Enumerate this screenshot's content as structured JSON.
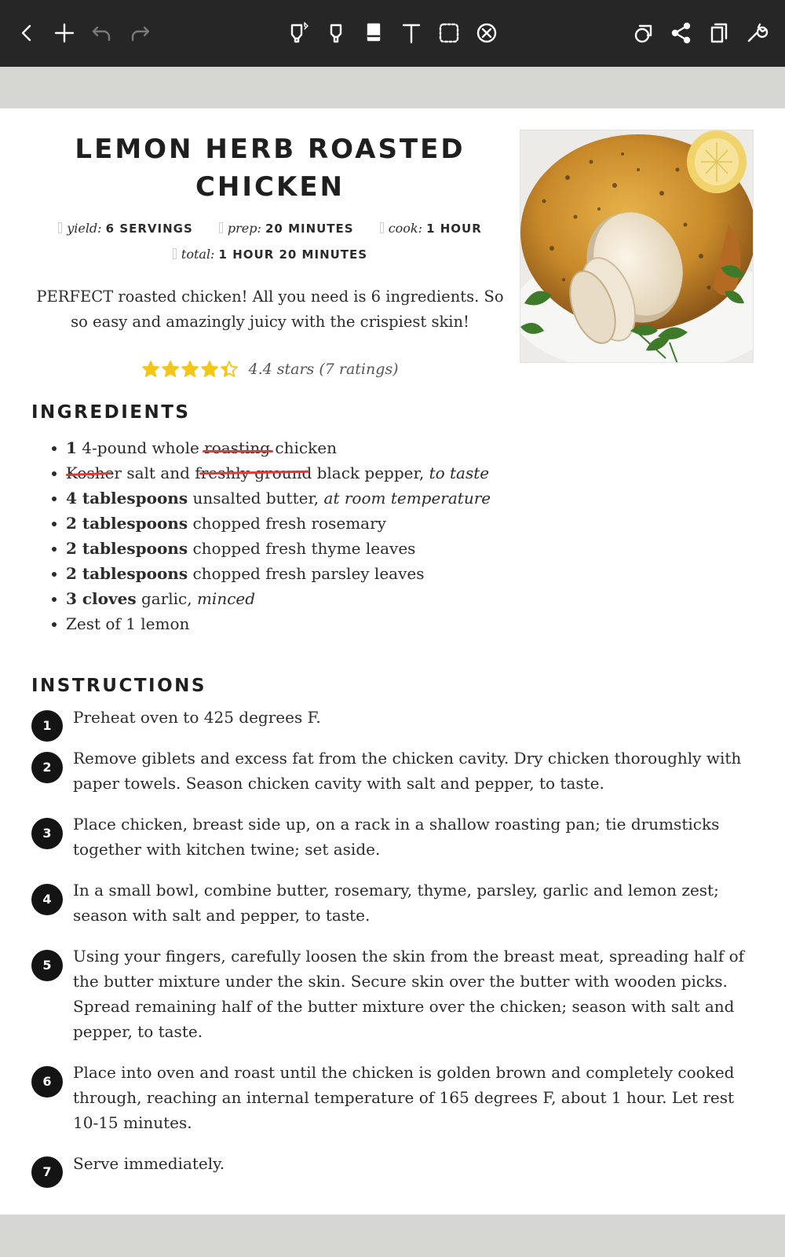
{
  "toolbar": {
    "left": [
      {
        "name": "back-button",
        "icon": "chevron-left-icon"
      },
      {
        "name": "add-page-button",
        "icon": "plus-icon"
      },
      {
        "name": "undo-button",
        "icon": "undo-icon"
      },
      {
        "name": "redo-button",
        "icon": "redo-icon"
      }
    ],
    "center": [
      {
        "name": "pen-tool-button",
        "icon": "pen-bluetooth-icon"
      },
      {
        "name": "highlighter-tool-button",
        "icon": "highlighter-icon"
      },
      {
        "name": "eraser-tool-button",
        "icon": "eraser-icon"
      },
      {
        "name": "text-tool-button",
        "icon": "text-icon"
      },
      {
        "name": "lasso-select-button",
        "icon": "lasso-icon"
      },
      {
        "name": "shapes-tool-button",
        "icon": "close-circle-icon"
      }
    ],
    "right": [
      {
        "name": "layers-button",
        "icon": "layers-icon"
      },
      {
        "name": "share-button",
        "icon": "share-icon"
      },
      {
        "name": "pages-button",
        "icon": "copy-icon"
      },
      {
        "name": "settings-button",
        "icon": "wrench-icon"
      }
    ]
  },
  "recipe": {
    "title": "LEMON HERB ROASTED CHICKEN",
    "meta": {
      "yield_label": "yield:",
      "yield_value": "6 SERVINGS",
      "prep_label": "prep:",
      "prep_value": "20 MINUTES",
      "cook_label": "cook:",
      "cook_value": "1 HOUR",
      "total_label": "total:",
      "total_value": "1 HOUR 20 MINUTES"
    },
    "summary": "PERFECT roasted chicken! All you need is 6 ingredients. So so easy and amazingly juicy with the crispiest skin!",
    "rating": {
      "value": 4.4,
      "text": "4.4 stars (7 ratings)",
      "max": 5
    },
    "star_color": "#f5c518",
    "image_icon": "roasted-chicken-photo",
    "ingredients_heading": "INGREDIENTS",
    "ingredients": [
      {
        "amount": "1",
        "text": " 4-pound whole ",
        "struck": "roasting",
        "rest": " chicken",
        "note": ""
      },
      {
        "amount": "",
        "text": "Kosher salt and freshly ground black pepper, ",
        "note": "to taste"
      },
      {
        "amount": "4 tablespoons",
        "text": " unsalted butter, ",
        "note": "at room temperature"
      },
      {
        "amount": "2 tablespoons",
        "text": " chopped fresh rosemary",
        "note": ""
      },
      {
        "amount": "2 tablespoons",
        "text": " chopped fresh thyme leaves",
        "note": ""
      },
      {
        "amount": "2 tablespoons",
        "text": " chopped fresh parsley leaves",
        "note": ""
      },
      {
        "amount": "3 cloves",
        "text": " garlic, ",
        "note": "minced"
      },
      {
        "amount": "",
        "text": "Zest of 1 lemon",
        "note": ""
      }
    ],
    "annotation_color": "#e53935",
    "instructions_heading": "INSTRUCTIONS",
    "steps": [
      {
        "n": "1",
        "text": "Preheat oven to 425 degrees F."
      },
      {
        "n": "2",
        "text": "Remove giblets and excess fat from the chicken cavity. Dry chicken thoroughly with paper towels. Season chicken cavity with salt and pepper, to taste."
      },
      {
        "n": "3",
        "text": "Place chicken, breast side up, on a rack in a shallow roasting pan; tie drumsticks together with kitchen twine; set aside."
      },
      {
        "n": "4",
        "text": "In a small bowl, combine butter, rosemary, thyme, parsley, garlic and lemon zest; season with salt and pepper, to taste."
      },
      {
        "n": "5",
        "text": "Using your fingers, carefully loosen the skin from the breast meat, spreading half of the butter mixture under the skin. Secure skin over the butter with wooden picks. Spread remaining half of the butter mixture over the chicken; season with salt and pepper, to taste."
      },
      {
        "n": "6",
        "text": "Place into oven and roast until the chicken is golden brown and completely cooked through, reaching an internal temperature of 165 degrees F, about 1 hour. Let rest 10-15 minutes."
      },
      {
        "n": "7",
        "text": "Serve immediately."
      }
    ]
  }
}
